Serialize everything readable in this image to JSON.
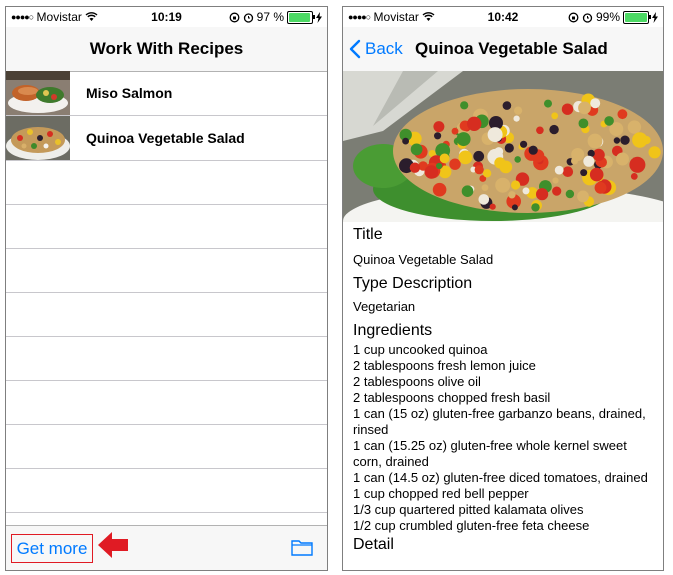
{
  "left_screen": {
    "status": {
      "signal_dots": "●●●●○",
      "carrier": "Movistar",
      "time": "10:19",
      "battery_text": "97 %",
      "battery_level": 0.97
    },
    "nav_title": "Work With Recipes",
    "recipes": [
      {
        "name": "Miso Salmon"
      },
      {
        "name": "Quinoa Vegetable Salad"
      }
    ],
    "toolbar": {
      "get_more_label": "Get more"
    }
  },
  "right_screen": {
    "status": {
      "signal_dots": "●●●●○",
      "carrier": "Movistar",
      "time": "10:42",
      "battery_text": "99%",
      "battery_level": 0.99
    },
    "back_label": "Back",
    "nav_title": "Quinoa Vegetable Salad",
    "fields": {
      "title_heading": "Title",
      "title_value": "Quinoa Vegetable Salad",
      "type_heading": "Type Description",
      "type_value": "Vegetarian",
      "ingredients_heading": "Ingredients",
      "ingredients": [
        "1 cup uncooked quinoa",
        "2 tablespoons fresh lemon juice",
        "2 tablespoons olive oil",
        "2 tablespoons chopped fresh basil",
        "1 can (15 oz) gluten-free garbanzo beans, drained, rinsed",
        "1 can (15.25 oz) gluten-free whole kernel sweet corn, drained",
        "1 can (14.5 oz) gluten-free diced tomatoes, drained",
        "1 cup chopped red bell pepper",
        "1/3 cup quartered pitted kalamata olives",
        "1/2 cup crumbled gluten-free feta cheese"
      ],
      "detail_heading": "Detail"
    }
  },
  "colors": {
    "accent": "#007aff",
    "annotation": "#e01b24",
    "battery": "#4cd964"
  },
  "icons": [
    "wifi-icon",
    "lock-rotation-icon",
    "alarm-icon",
    "charging-icon",
    "folder-icon",
    "back-chevron-icon",
    "red-arrow-icon"
  ]
}
